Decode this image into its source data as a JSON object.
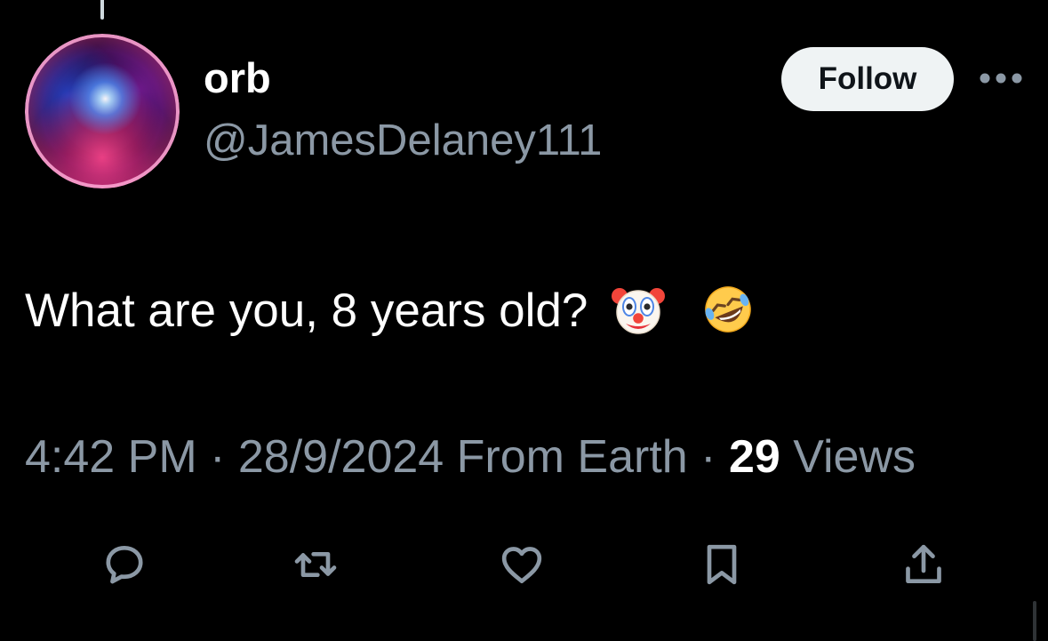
{
  "author": {
    "display_name": "orb",
    "handle": "@JamesDelaney111",
    "avatar_icon": "cosmic-orb-avatar"
  },
  "header": {
    "follow_label": "Follow",
    "more_icon": "more-horizontal-icon"
  },
  "tweet": {
    "text": "What are you, 8 years old?",
    "emojis": [
      "clown-face-emoji",
      "rolling-on-floor-laughing-emoji"
    ]
  },
  "meta": {
    "time": "4:42 PM",
    "separator": " · ",
    "date": "28/9/2024",
    "source": "From Earth",
    "views_count": "29",
    "views_label": "Views"
  },
  "actions": [
    {
      "name": "reply",
      "icon": "reply-icon"
    },
    {
      "name": "retweet",
      "icon": "retweet-icon"
    },
    {
      "name": "like",
      "icon": "heart-icon"
    },
    {
      "name": "bookmark",
      "icon": "bookmark-icon"
    },
    {
      "name": "share",
      "icon": "share-icon"
    }
  ],
  "colors": {
    "background": "#000000",
    "primary_text": "#ffffff",
    "secondary_text": "#8b98a5",
    "follow_button_bg": "#eff3f4",
    "follow_button_text": "#0f1419"
  }
}
